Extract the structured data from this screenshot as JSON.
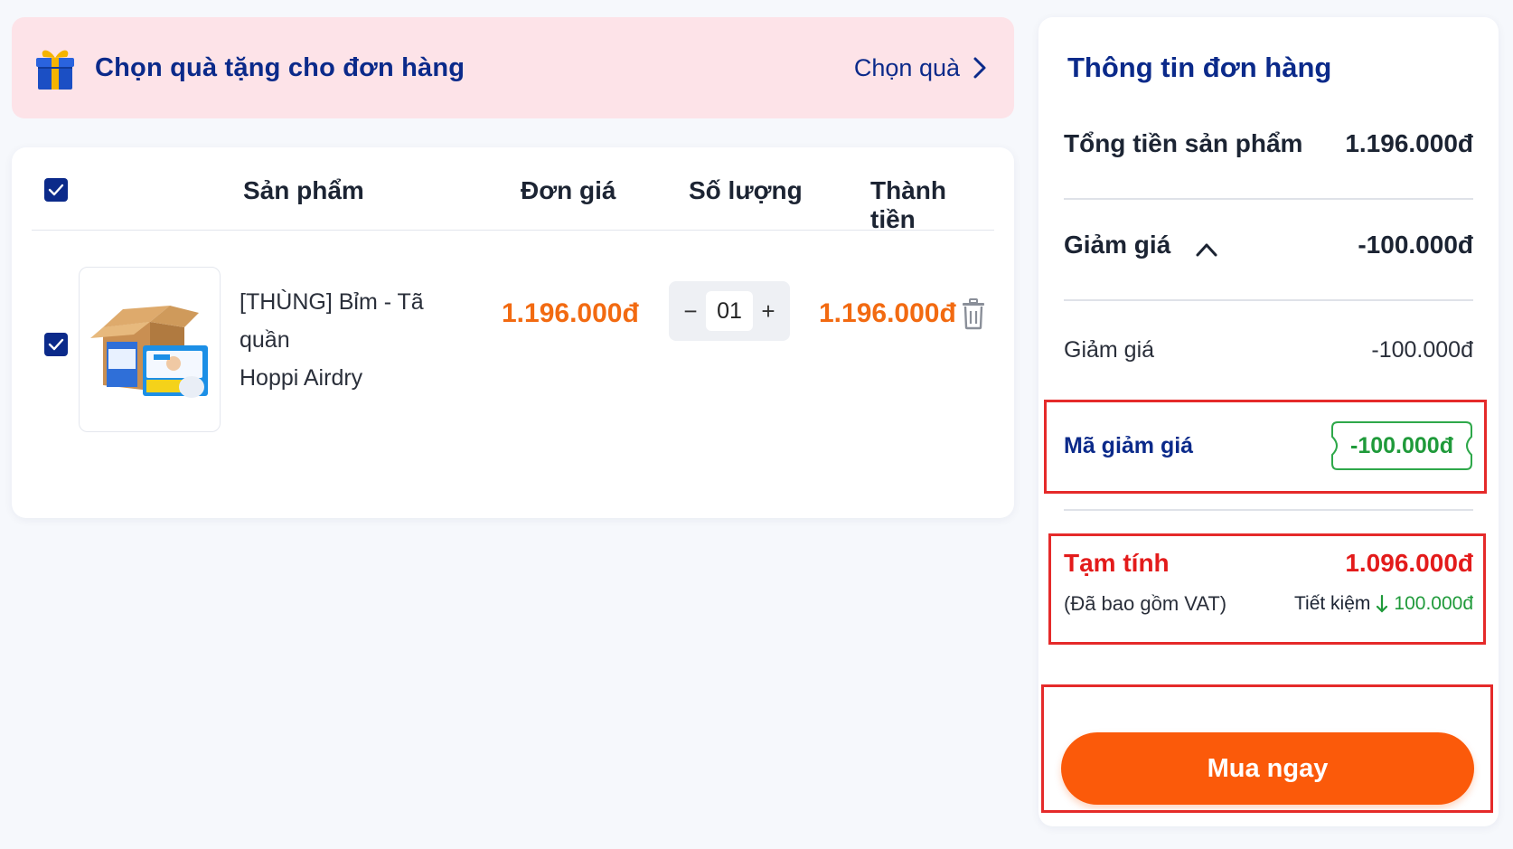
{
  "colors": {
    "primary": "#0b2a8a",
    "accent_orange": "#fb5a0a",
    "price_orange": "#f26a11",
    "highlight_red": "#e52a2a",
    "saving_green": "#1f9a3a",
    "banner_pink": "#fde3e8"
  },
  "gift_banner": {
    "icon": "gift-icon",
    "title": "Chọn quà tặng cho đơn hàng",
    "action_label": "Chọn quà",
    "action_icon": "chevron-right-icon"
  },
  "cart": {
    "select_all_checked": true,
    "columns": [
      "Sản phẩm",
      "Đơn giá",
      "Số lượng",
      "Thành tiền"
    ],
    "items": [
      {
        "checked": true,
        "name_line1": "[THÙNG] Bỉm - Tã quần",
        "name_line2": "Hoppi Airdry",
        "unit_price": "1.196.000đ",
        "quantity": "01",
        "qty_minus": "−",
        "qty_plus": "+",
        "total_price": "1.196.000đ",
        "delete_icon": "trash-icon"
      }
    ]
  },
  "summary": {
    "title": "Thông tin đơn hàng",
    "product_total_label": "Tổng tiền sản phẩm",
    "product_total_value": "1.196.000đ",
    "discount_label": "Giảm giá",
    "discount_value": "-100.000đ",
    "discount_detail_label": "Giảm giá",
    "discount_detail_value": "-100.000đ",
    "voucher_label": "Mã giảm giá",
    "voucher_value": "-100.000đ",
    "subtotal_label": "Tạm tính",
    "subtotal_value": "1.096.000đ",
    "vat_note": "(Đã bao gồm VAT)",
    "saving_label": "Tiết kiệm",
    "saving_value": "100.000đ",
    "buy_button": "Mua ngay"
  }
}
